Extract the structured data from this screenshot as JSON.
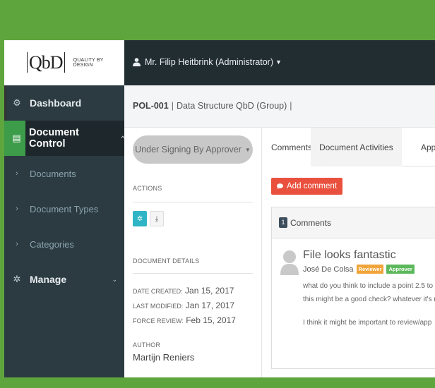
{
  "brand": {
    "logo_text": "QbD",
    "tagline": "QUALITY BY DESIGN"
  },
  "header": {
    "user": "Mr. Filip Heitbrink (Administrator)"
  },
  "sidebar": {
    "items": [
      {
        "label": "Dashboard",
        "icon": "dashboard-icon"
      },
      {
        "label": "Document Control",
        "icon": "document-icon",
        "active": true
      },
      {
        "label": "Documents",
        "icon": "chevron-right-icon"
      },
      {
        "label": "Document Types",
        "icon": "chevron-right-icon"
      },
      {
        "label": "Categories",
        "icon": "chevron-right-icon"
      },
      {
        "label": "Manage",
        "icon": "gear-icon"
      }
    ]
  },
  "breadcrumb": {
    "code": "POL-001",
    "title": "Data Structure QbD (Group)"
  },
  "status": {
    "label": "Under Signing By Approver"
  },
  "actions": {
    "label": "ACTIONS"
  },
  "details": {
    "label": "DOCUMENT DETAILS",
    "date_created_key": "DATE CREATED:",
    "date_created": "Jan 15, 2017",
    "last_modified_key": "LAST MODIFIED:",
    "last_modified": "Jan 17, 2017",
    "force_review_key": "FORCE REVIEW:",
    "force_review": "Feb 15, 2017",
    "author_key": "AUTHOR",
    "author": "Martijn Reniers"
  },
  "tabs": [
    {
      "label": "Comments",
      "active": true
    },
    {
      "label": "Document Activities"
    },
    {
      "label": "Approve"
    }
  ],
  "comments": {
    "add_label": "Add comment",
    "count": "1",
    "header_label": "Comments",
    "items": [
      {
        "title": "File looks fantastic",
        "author": "José De Colsa",
        "tags": [
          "Reviewer",
          "Approver"
        ],
        "lines": [
          "what do you think to include a point 2.5 to",
          "this might be a good check? whatever it's r",
          "I think  it might be important to review/app"
        ]
      }
    ]
  },
  "colors": {
    "frame_green": "#5fa53d",
    "topbar": "#222d32",
    "sidebar": "#2c3b41",
    "active_green": "#3c9c4a",
    "add_comment_red": "#e9513e",
    "reviewer_orange": "#f0a43a",
    "approver_green": "#5cb85c"
  }
}
